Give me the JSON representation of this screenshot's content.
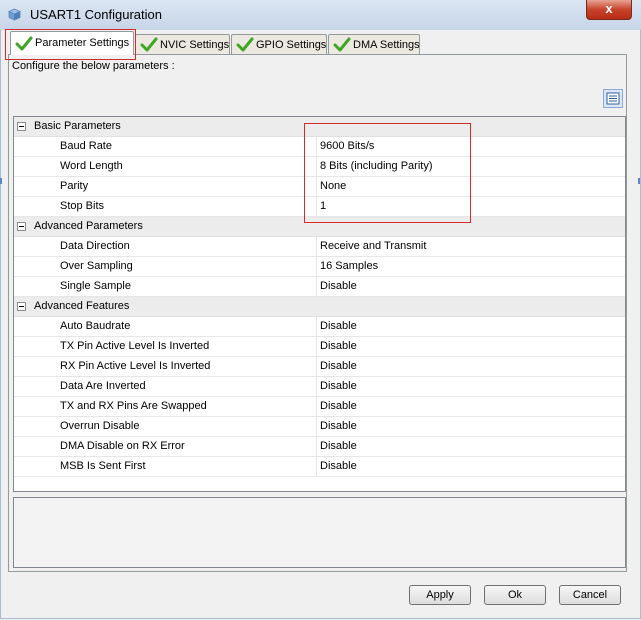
{
  "window": {
    "title": "USART1 Configuration",
    "close_label": "x"
  },
  "tabs": [
    {
      "label": "Parameter Settings",
      "active": true
    },
    {
      "label": "NVIC Settings",
      "active": false
    },
    {
      "label": "GPIO Settings",
      "active": false
    },
    {
      "label": "DMA Settings",
      "active": false
    }
  ],
  "panel": {
    "instruction": "Configure the below parameters :"
  },
  "groups": [
    {
      "name": "Basic Parameters",
      "rows": [
        {
          "name": "Baud Rate",
          "value": "9600 Bits/s"
        },
        {
          "name": "Word Length",
          "value": "8 Bits (including Parity)"
        },
        {
          "name": "Parity",
          "value": "None"
        },
        {
          "name": "Stop Bits",
          "value": "1"
        }
      ]
    },
    {
      "name": "Advanced Parameters",
      "rows": [
        {
          "name": "Data Direction",
          "value": "Receive and Transmit"
        },
        {
          "name": "Over Sampling",
          "value": "16 Samples"
        },
        {
          "name": "Single Sample",
          "value": "Disable"
        }
      ]
    },
    {
      "name": "Advanced Features",
      "rows": [
        {
          "name": "Auto Baudrate",
          "value": "Disable"
        },
        {
          "name": "TX Pin Active Level Is Inverted",
          "value": "Disable"
        },
        {
          "name": "RX Pin Active Level Is Inverted",
          "value": "Disable"
        },
        {
          "name": "Data Are Inverted",
          "value": "Disable"
        },
        {
          "name": "TX and RX Pins Are Swapped",
          "value": "Disable"
        },
        {
          "name": "Overrun Disable",
          "value": "Disable"
        },
        {
          "name": "DMA Disable on RX Error",
          "value": "Disable"
        },
        {
          "name": "MSB Is Sent First",
          "value": "Disable"
        }
      ]
    }
  ],
  "buttons": {
    "apply": "Apply",
    "ok": "Ok",
    "cancel": "Cancel"
  },
  "colors": {
    "highlight": "#d42a2a",
    "check": "#3fa524"
  }
}
